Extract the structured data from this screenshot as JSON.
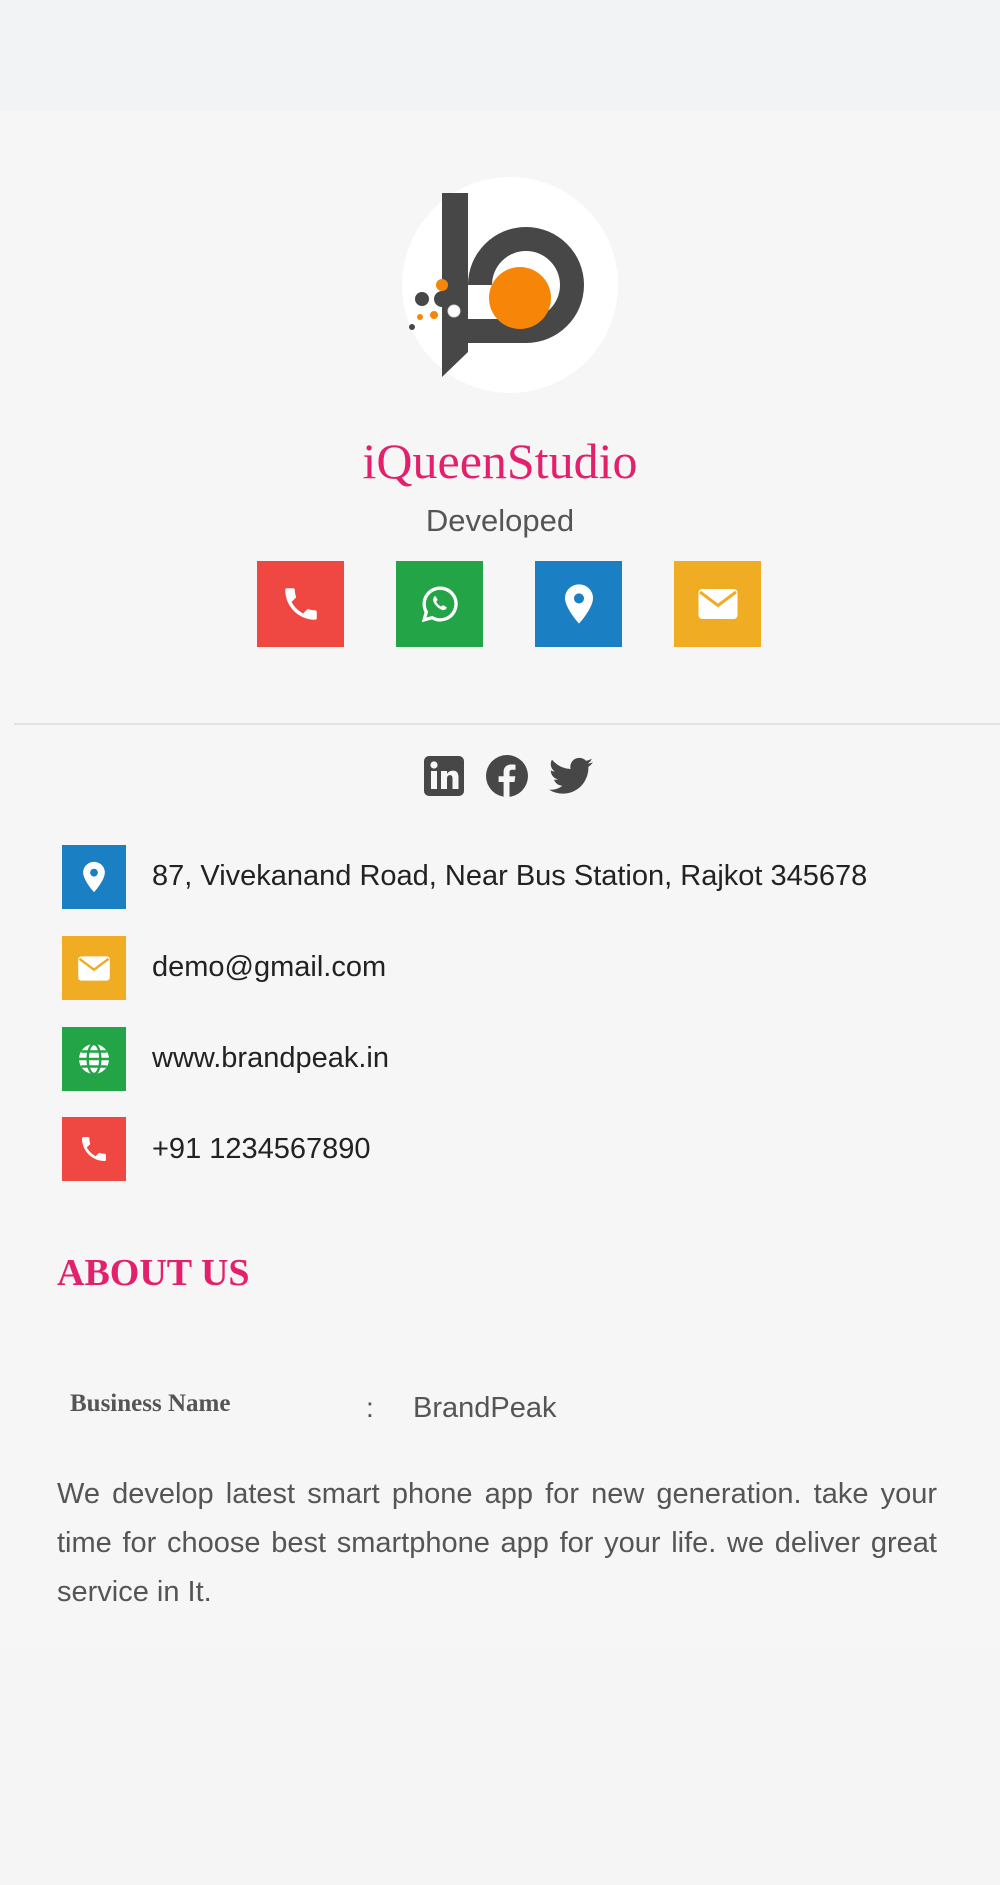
{
  "header": {
    "logo_icon": "brandpeak-logo",
    "title": "iQueenStudio",
    "subtitle": "Developed"
  },
  "actions": [
    {
      "name": "call",
      "icon": "phone-icon",
      "color": "#ef4843"
    },
    {
      "name": "whatsapp",
      "icon": "whatsapp-icon",
      "color": "#22a447"
    },
    {
      "name": "location",
      "icon": "location-pin-icon",
      "color": "#1a7fc3"
    },
    {
      "name": "email",
      "icon": "envelope-icon",
      "color": "#f0ac22"
    }
  ],
  "social": [
    {
      "name": "linkedin",
      "icon": "linkedin-icon"
    },
    {
      "name": "facebook",
      "icon": "facebook-icon"
    },
    {
      "name": "twitter",
      "icon": "twitter-icon"
    }
  ],
  "contact": {
    "address": "87, Vivekanand Road, Near Bus Station, Rajkot 345678",
    "email": "demo@gmail.com",
    "website": "www.brandpeak.in",
    "phone": "+91 1234567890"
  },
  "about": {
    "title": "ABOUT US",
    "business_label": "Business Name",
    "separator": ":",
    "business_value": "BrandPeak",
    "description": "We develop latest smart phone app for new generation. take your time for choose best smartphone app for your life. we deliver great service in It."
  },
  "colors": {
    "accent": "#e2206b",
    "red": "#ef4843",
    "green": "#22a447",
    "blue": "#1a7fc3",
    "yellow": "#f0ac22",
    "icon_dark": "#474747"
  }
}
